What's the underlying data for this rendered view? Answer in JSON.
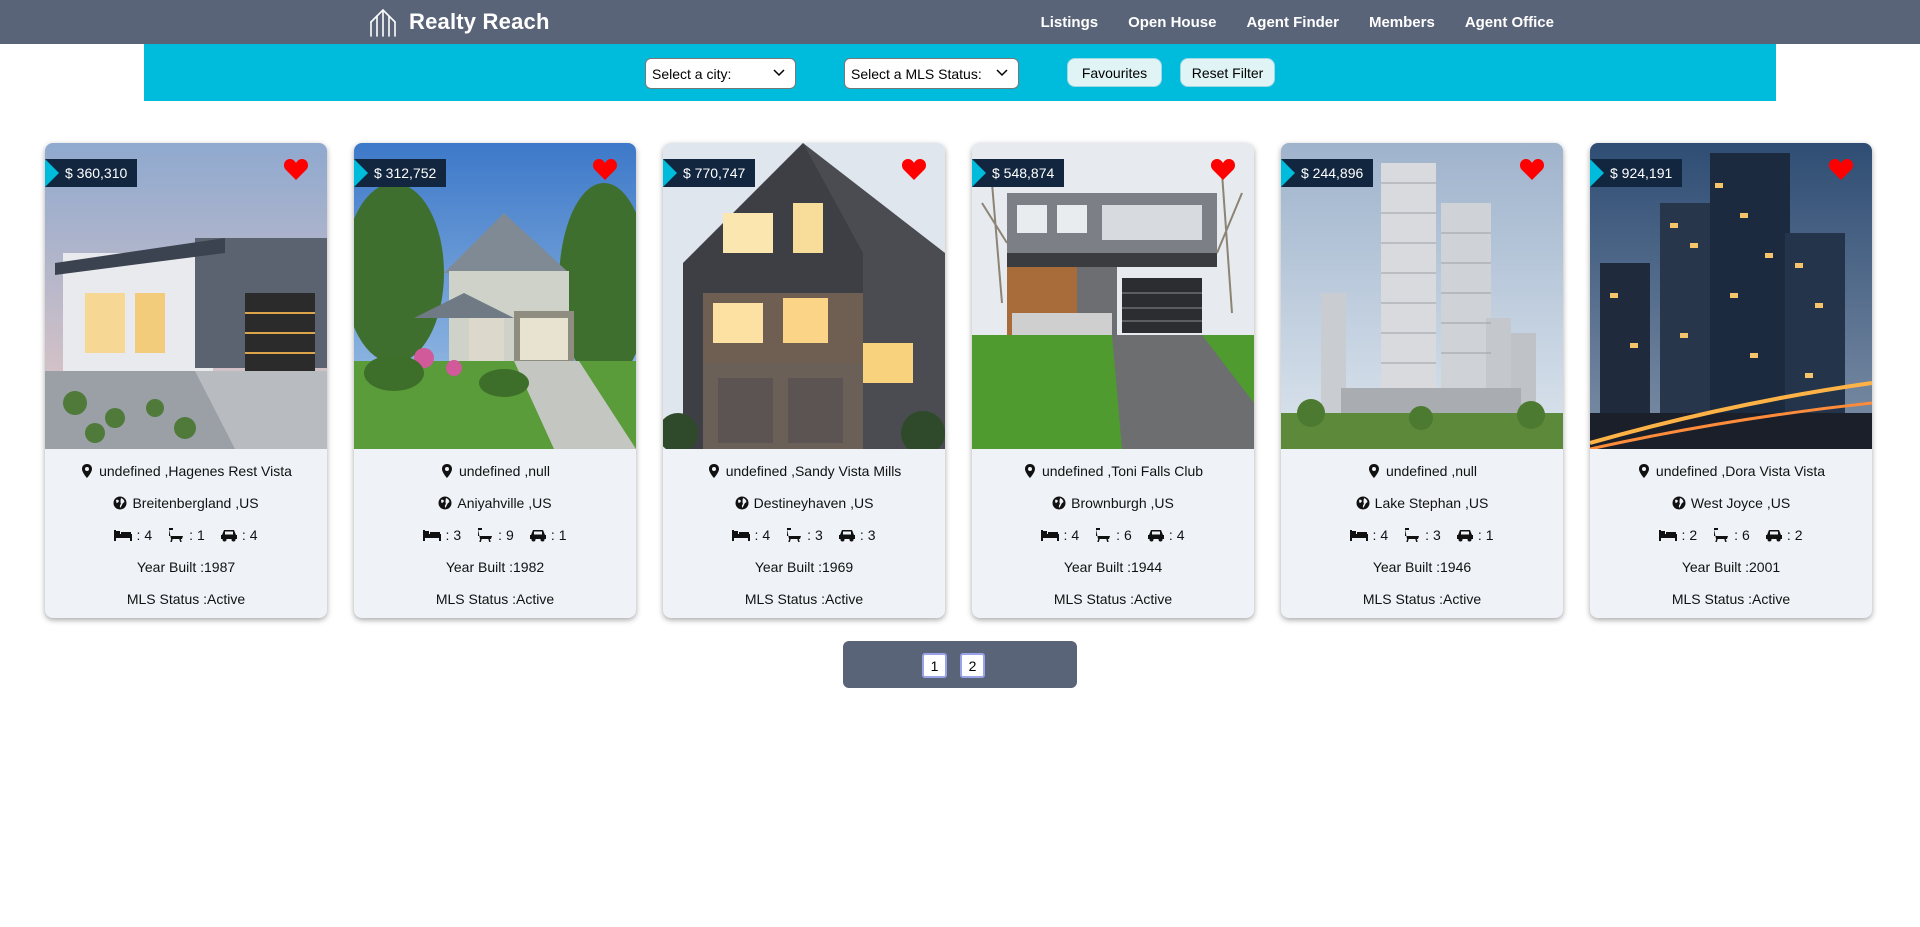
{
  "brand": {
    "name": "Realty Reach",
    "logo_icon": "building-icon"
  },
  "nav": [
    "Listings",
    "Open House",
    "Agent Finder",
    "Members",
    "Agent Office"
  ],
  "filters": {
    "city": "Select a city:",
    "status": "Select a MLS Status:",
    "favourites": "Favourites",
    "reset": "Reset Filter"
  },
  "colors": {
    "header": "#5a6479",
    "filter_band": "#00bcdc",
    "price_tag": "#12263f",
    "heart": "#ff0000",
    "card_bg": "#eff3f8"
  },
  "listings": [
    {
      "price": "$ 360,310",
      "address": "undefined ,Hagenes Rest Vista",
      "city": "Breitenbergland ,US",
      "beds": "4",
      "baths": "1",
      "cars": "4",
      "year": "Year Built :1987",
      "status": "MLS Status :Active"
    },
    {
      "price": "$ 312,752",
      "address": "undefined ,null",
      "city": "Aniyahville ,US",
      "beds": "3",
      "baths": "9",
      "cars": "1",
      "year": "Year Built :1982",
      "status": "MLS Status :Active"
    },
    {
      "price": "$ 770,747",
      "address": "undefined ,Sandy Vista Mills",
      "city": "Destineyhaven ,US",
      "beds": "4",
      "baths": "3",
      "cars": "3",
      "year": "Year Built :1969",
      "status": "MLS Status :Active"
    },
    {
      "price": "$ 548,874",
      "address": "undefined ,Toni Falls Club",
      "city": "Brownburgh ,US",
      "beds": "4",
      "baths": "6",
      "cars": "4",
      "year": "Year Built :1944",
      "status": "MLS Status :Active"
    },
    {
      "price": "$ 244,896",
      "address": "undefined ,null",
      "city": "Lake Stephan ,US",
      "beds": "4",
      "baths": "3",
      "cars": "1",
      "year": "Year Built :1946",
      "status": "MLS Status :Active"
    },
    {
      "price": "$ 924,191",
      "address": "undefined ,Dora Vista Vista",
      "city": "West Joyce ,US",
      "beds": "2",
      "baths": "6",
      "cars": "2",
      "year": "Year Built :2001",
      "status": "MLS Status :Active"
    }
  ],
  "pagination": {
    "pages": [
      "1",
      "2"
    ]
  }
}
